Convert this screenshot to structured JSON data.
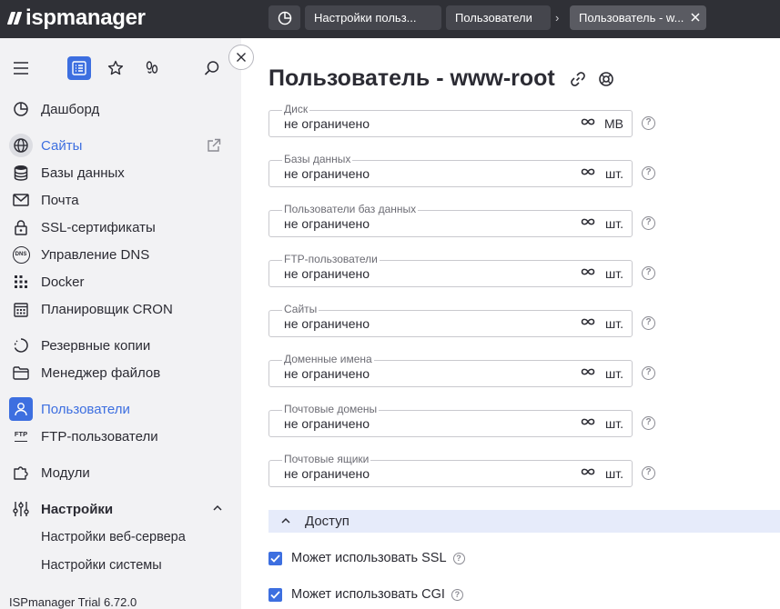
{
  "app": {
    "logo_text": "ispmanager"
  },
  "breadcrumbs": [
    {
      "label": "Настройки польз..."
    },
    {
      "label": "Пользователи"
    },
    {
      "label": "Пользователь - w..."
    }
  ],
  "breadcrumb_separator": "›",
  "sidebar": {
    "tools": [
      "menu-icon",
      "list-icon",
      "star-icon",
      "footprints-icon",
      "search-icon"
    ],
    "items": [
      {
        "label": "Дашборд",
        "icon": "dashboard-icon"
      },
      {
        "label": "Сайты",
        "icon": "globe-icon",
        "active": true
      },
      {
        "label": "Базы данных",
        "icon": "database-icon"
      },
      {
        "label": "Почта",
        "icon": "mail-icon"
      },
      {
        "label": "SSL-сертификаты",
        "icon": "lock-icon"
      },
      {
        "label": "Управление DNS",
        "icon": "dns-icon",
        "icon_text": "DNS"
      },
      {
        "label": "Docker",
        "icon": "docker-icon"
      },
      {
        "label": "Планировщик CRON",
        "icon": "calendar-icon"
      },
      {
        "label": "Резервные копии",
        "icon": "backup-icon"
      },
      {
        "label": "Менеджер файлов",
        "icon": "folder-icon"
      },
      {
        "label": "Пользователи",
        "icon": "user-icon",
        "active": true
      },
      {
        "label": "FTP-пользователи",
        "icon": "ftp-icon",
        "icon_text": "FTP"
      },
      {
        "label": "Модули",
        "icon": "puzzle-icon"
      },
      {
        "label": "Настройки",
        "icon": "sliders-icon",
        "expanded": true
      }
    ],
    "sub_items": [
      {
        "label": "Настройки веб-сервера"
      },
      {
        "label": "Настройки системы"
      }
    ],
    "version": "ISPmanager Trial 6.72.0"
  },
  "main": {
    "title": "Пользователь - www-root",
    "limits": [
      {
        "label": "Диск",
        "value": "не ограничено",
        "unit": "MB"
      },
      {
        "label": "Базы данных",
        "value": "не ограничено",
        "unit": "шт."
      },
      {
        "label": "Пользователи баз данных",
        "value": "не ограничено",
        "unit": "шт."
      },
      {
        "label": "FTP-пользователи",
        "value": "не ограничено",
        "unit": "шт."
      },
      {
        "label": "Сайты",
        "value": "не ограничено",
        "unit": "шт."
      },
      {
        "label": "Доменные имена",
        "value": "не ограничено",
        "unit": "шт."
      },
      {
        "label": "Почтовые домены",
        "value": "не ограничено",
        "unit": "шт."
      },
      {
        "label": "Почтовые ящики",
        "value": "не ограничено",
        "unit": "шт."
      }
    ],
    "help_glyph": "?",
    "section": {
      "label": "Доступ",
      "expanded": true
    },
    "checkboxes": [
      {
        "label": "Может использовать SSL",
        "checked": true
      },
      {
        "label": "Может использовать CGI",
        "checked": true
      }
    ]
  },
  "colors": {
    "accent": "#3d6fe0",
    "topbar": "#2f3036",
    "sidebar": "#f2f2f4",
    "section_bg": "#e6ebfa"
  }
}
